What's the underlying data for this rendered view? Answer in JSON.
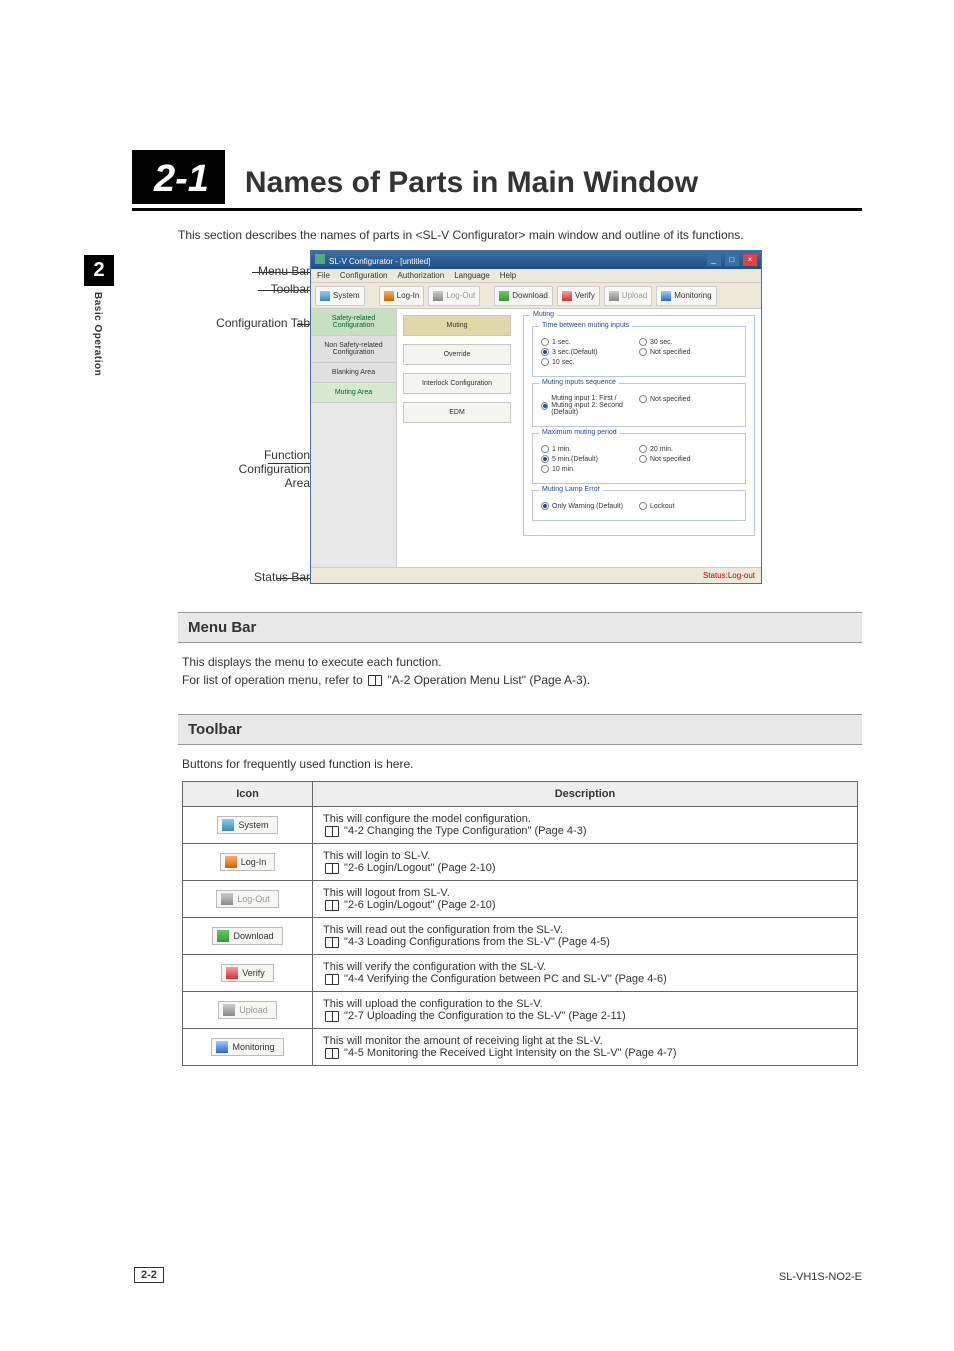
{
  "chapter": {
    "number": "2-1",
    "title": "Names of Parts in Main Window"
  },
  "intro": "This section describes the names of parts in <SL-V Configurator> main window and outline of its functions.",
  "side_tab": {
    "num": "2",
    "label": "Basic Operation"
  },
  "fig_labels": {
    "menu_bar": "Menu Bar",
    "toolbar": "Toolbar",
    "config_tab": "Configuration Tab",
    "function": "Function",
    "configuration": "Configuration",
    "area": "Area",
    "status_bar": "Status Bar"
  },
  "shot": {
    "title": "SL-V Configurator - [untitled]",
    "menus": [
      "File",
      "Configuration",
      "Authorization",
      "Language",
      "Help"
    ],
    "toolbar": {
      "system": "System",
      "login": "Log-In",
      "logout": "Log-Out",
      "download": "Download",
      "verify": "Verify",
      "upload": "Upload",
      "monitoring": "Monitoring"
    },
    "tabs": {
      "safety": "Safety-related Configuration",
      "nonsafety": "Non Safety-related Configuration",
      "blanking": "Blanking Area",
      "muting_area": "Muting Area"
    },
    "fn_buttons": [
      "Muting",
      "Override",
      "Interlock Configuration",
      "EDM"
    ],
    "panel": {
      "muting": "Muting",
      "time_between": "Time between muting inputs",
      "t1": "1 sec.",
      "t3": "3 sec.(Default)",
      "t10": "10 sec.",
      "t30": "30 sec.",
      "tns": "Not specified",
      "seq": "Muting inputs sequence",
      "seq_opt": "Muting input 1: First /\nMuting input 2: Second (Default)",
      "seq_ns": "Not specified",
      "max_period": "Maximum muting period",
      "m1": "1 min.",
      "m5": "5 min.(Default)",
      "m10": "10 min.",
      "m20": "20 min.",
      "mns": "Not specified",
      "lamp": "Muting Lamp Error",
      "lamp_warn": "Only Warning (Default)",
      "lamp_lock": "Lockout"
    },
    "status": "Status:Log-out"
  },
  "sections": {
    "menu_bar": {
      "head": "Menu Bar",
      "p1": "This displays the menu to execute each function.",
      "p2a": "For list of operation menu, refer to ",
      "p2b": "\"A-2 Operation Menu List\" (Page A-3)."
    },
    "toolbar": {
      "head": "Toolbar",
      "intro": "Buttons for frequently used function is here.",
      "th_icon": "Icon",
      "th_desc": "Description",
      "rows": [
        {
          "icon": "system",
          "label": "System",
          "d1": "This will configure the model configuration.",
          "d2": "\"4-2 Changing the Type Configuration\" (Page 4-3)"
        },
        {
          "icon": "login",
          "label": "Log-In",
          "d1": "This will login to SL-V.",
          "d2": "\"2-6 Login/Logout\" (Page 2-10)"
        },
        {
          "icon": "logout",
          "label": "Log-Out",
          "d1": "This will logout from SL-V.",
          "d2": "\"2-6 Login/Logout\" (Page 2-10)"
        },
        {
          "icon": "download",
          "label": "Download",
          "d1": "This will read out the configuration from the SL-V.",
          "d2": "\"4-3 Loading Configurations from the SL-V\" (Page 4-5)"
        },
        {
          "icon": "verify",
          "label": "Verify",
          "d1": "This will verify the configuration with the SL-V.",
          "d2": "\"4-4 Verifying the Configuration between PC and SL-V\" (Page 4-6)"
        },
        {
          "icon": "upload",
          "label": "Upload",
          "d1": "This will upload the configuration to the SL-V.",
          "d2": "\"2-7 Uploading the Configuration to the SL-V\" (Page 2-11)"
        },
        {
          "icon": "monitor",
          "label": "Monitoring",
          "d1": "This will monitor the amount of receiving light at the SL-V.",
          "d2": "\"4-5 Monitoring the Received Light Intensity on the SL-V\" (Page 4-7)"
        }
      ]
    }
  },
  "footer": {
    "page": "2-2",
    "doc": "SL-VH1S-NO2-E"
  }
}
